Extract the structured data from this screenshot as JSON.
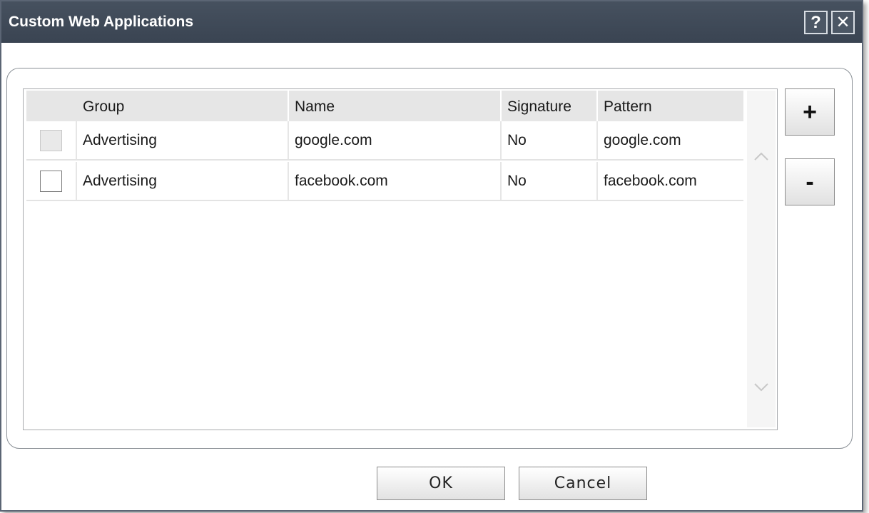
{
  "window": {
    "title": "Custom Web Applications",
    "help_label": "?",
    "close_label": "✕",
    "colors": {
      "titlebar": "#3f4957",
      "title_text": "#ffffff"
    }
  },
  "table": {
    "columns": [
      "",
      "Group",
      "Name",
      "Signature",
      "Pattern"
    ],
    "rows": [
      {
        "checked": false,
        "disabled": true,
        "group": "Advertising",
        "name": "google.com",
        "signature": "No",
        "pattern": "google.com"
      },
      {
        "checked": false,
        "disabled": false,
        "group": "Advertising",
        "name": "facebook.com",
        "signature": "No",
        "pattern": "facebook.com"
      }
    ]
  },
  "actions": {
    "add_label": "+",
    "remove_label": "-"
  },
  "footer": {
    "ok_label": "OK",
    "cancel_label": "Cancel"
  },
  "icons": {
    "help": "help-icon",
    "close": "close-icon",
    "scroll_up": "chevron-up-icon",
    "scroll_down": "chevron-down-icon"
  }
}
